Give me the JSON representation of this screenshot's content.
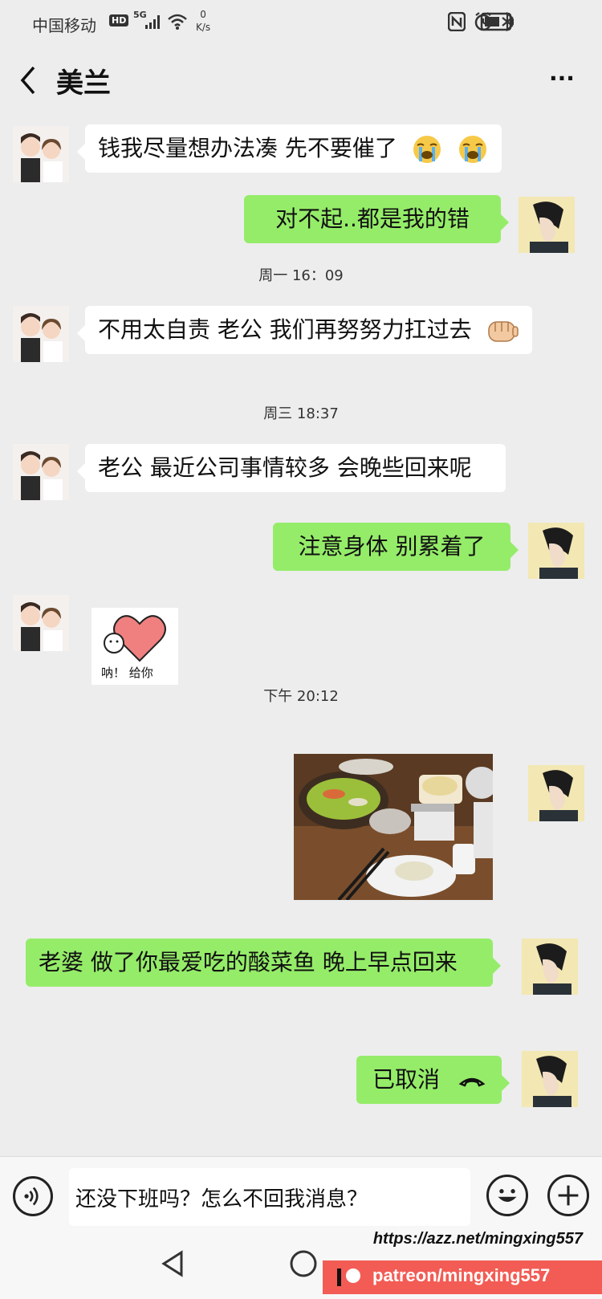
{
  "status_bar": {
    "carrier": "中国移动",
    "hd": "HD",
    "network": "5G",
    "speed_value": "0",
    "speed_unit": "K/s",
    "icons": [
      "nfc-icon",
      "alarm-icon",
      "bluetooth-icon",
      "battery-icon"
    ]
  },
  "header": {
    "title": "美兰",
    "back_icon": "chevron-left-icon",
    "more_label": "···"
  },
  "messages": [
    {
      "side": "in",
      "text": "钱我尽量想办法凑 先不要催了",
      "emojis": [
        "crying-face-emoji",
        "crying-face-emoji"
      ]
    },
    {
      "side": "out",
      "text": "对不起..都是我的错"
    },
    {
      "time": "周一 16：09"
    },
    {
      "side": "in",
      "text": "不用太自责 老公 我们再努努力扛过去",
      "emojis": [
        "fist-emoji"
      ]
    },
    {
      "time": "周三 18:37"
    },
    {
      "side": "in",
      "text": "老公 最近公司事情较多 会晚些回来呢"
    },
    {
      "side": "out",
      "text": "注意身体 别累着了"
    },
    {
      "side": "in",
      "sticker_caption": "呐！ 给你"
    },
    {
      "time": "下午 20:12"
    },
    {
      "side": "out",
      "image": "dinner-photo"
    },
    {
      "side": "out",
      "text": "老婆  做了你最爱吃的酸菜鱼 晚上早点回来"
    },
    {
      "side": "out",
      "text": "已取消",
      "icon": "hangup-icon"
    }
  ],
  "input": {
    "value": "还没下班吗？怎么不回我消息？"
  },
  "watermark": {
    "url": "https://azz.net/mingxing557",
    "patreon": "patreon/mingxing557"
  },
  "colors": {
    "background": "#ededed",
    "outgoing_bubble": "#95ec69",
    "incoming_bubble": "#ffffff",
    "patreon": "#f25c54"
  }
}
